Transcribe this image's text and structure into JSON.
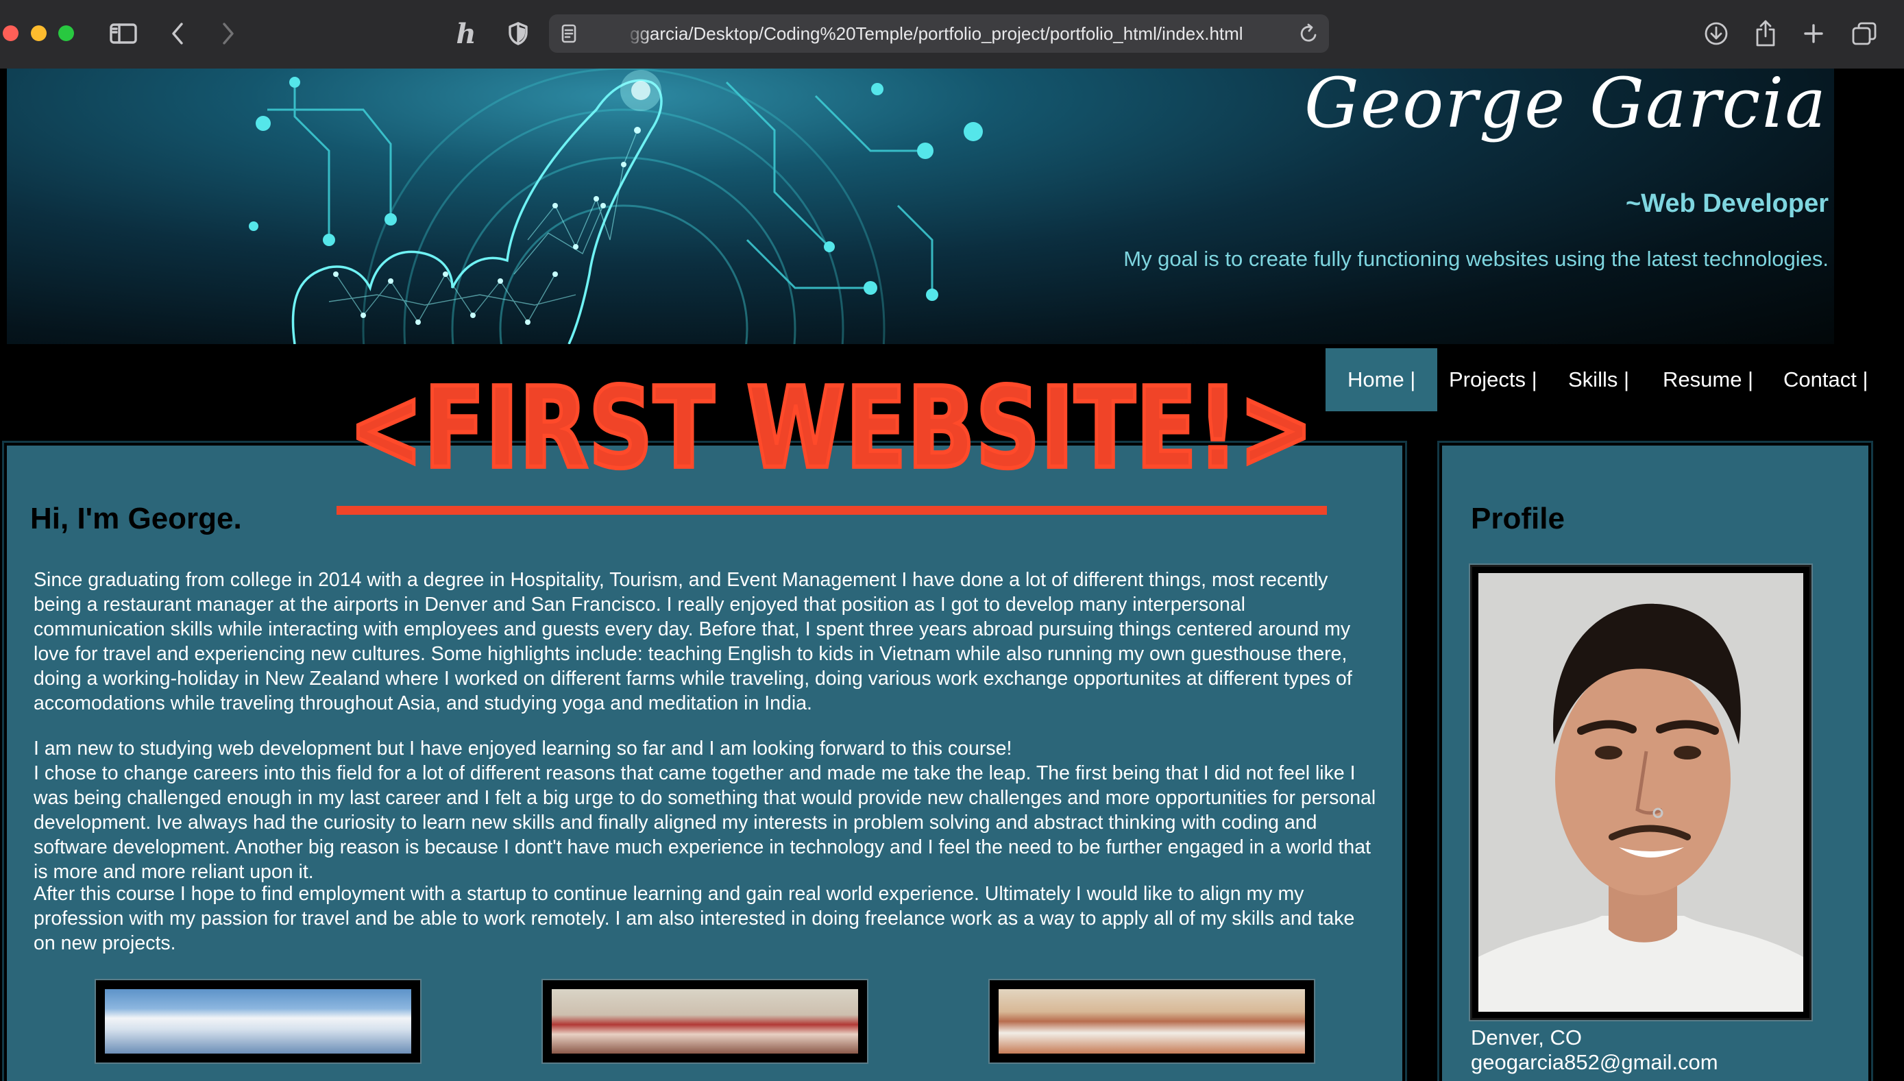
{
  "browser": {
    "url": "ggarcia/Desktop/Coding%20Temple/portfolio_project/portfolio_html/index.html",
    "icons": [
      "sidebar-icon",
      "back-icon",
      "forward-icon",
      "honey-extension-icon",
      "privacy-shield-icon",
      "page-icon",
      "reload-icon",
      "download-icon",
      "share-icon",
      "new-tab-icon",
      "tab-overview-icon"
    ]
  },
  "hero": {
    "name": "George Garcia",
    "role": "~Web Developer",
    "goal": "My goal is to create fully functioning websites using the latest technologies."
  },
  "nav": {
    "items": [
      {
        "label": "Home |",
        "active": true
      },
      {
        "label": "Projects |",
        "active": false
      },
      {
        "label": "Skills |",
        "active": false
      },
      {
        "label": "Resume |",
        "active": false
      },
      {
        "label": "Contact |",
        "active": false
      }
    ]
  },
  "stamp": "<FIRST WEBSITE!>",
  "main": {
    "heading": "Hi, I'm George.",
    "paragraphs": [
      "Since graduating from college in 2014 with a degree in Hospitality, Tourism, and Event Management I have done a lot of different things, most recently being a restaurant manager at the airports in Denver and San Francisco. I really enjoyed that position as I got to develop many interpersonal communication skills while interacting with employees and guests every day. Before that, I spent three years abroad pursuing things centered around my love for travel and experiencing new cultures. Some highlights include: teaching English to kids in Vietnam while also running my own guesthouse there, doing a working-holiday in New Zealand where I worked on different farms while traveling, doing various work exchange opportunites at different types of accomodations while traveling throughout Asia, and studying yoga and meditation in India.",
      "I am new to studying web development but I have enjoyed learning so far and I am looking forward to this course!",
      "I chose to change careers into this field for a lot of different reasons that came together and made me take the leap. The first being that I did not feel like I was being challenged enough in my last career and I felt a big urge to do something that would provide new challenges and more opportunities for personal development. Ive always had the curiosity to learn new skills and finally aligned my interests in problem solving and abstract thinking with coding and software development. Another big reason is because I dont't have much experience in technology and I feel the need to be further engaged in a world that is more and more reliant upon it.",
      "After this course I hope to find employment with a startup to continue learning and gain real world experience. Ultimately I would like to align my my profession with my passion for travel and be able to work remotely. I am also interested in doing freelance work as a way to apply all of my skills and take on new projects."
    ]
  },
  "profile": {
    "heading": "Profile",
    "location": "Denver, CO",
    "email": "geogarcia852@gmail.com"
  }
}
